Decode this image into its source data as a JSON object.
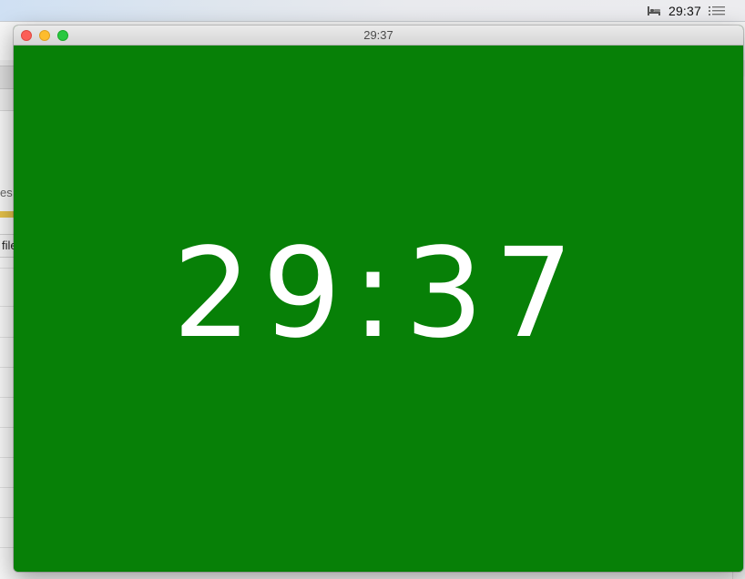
{
  "menubar": {
    "icons": [
      "bed-icon",
      "list-icon"
    ],
    "clock": "29:37"
  },
  "background_app": {
    "side_label": "es",
    "file_tab_label": "file"
  },
  "timer_window": {
    "title": "29:37",
    "display_time": "29:37",
    "background_color": "#078007",
    "text_color": "#ffffff"
  }
}
